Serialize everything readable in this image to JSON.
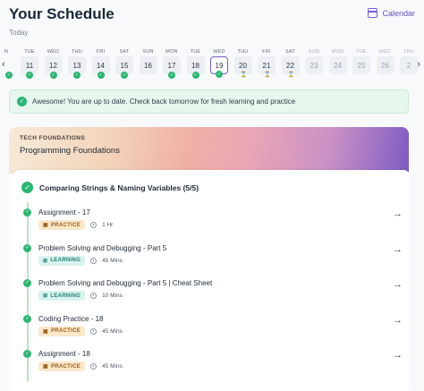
{
  "header": {
    "title": "Your Schedule",
    "calendar_label": "Calendar",
    "subtitle": "Today"
  },
  "week": {
    "days": [
      {
        "label": "N",
        "num": "",
        "state": "done"
      },
      {
        "label": "TUE",
        "num": "11",
        "state": "done"
      },
      {
        "label": "WED",
        "num": "12",
        "state": "done"
      },
      {
        "label": "THU",
        "num": "13",
        "state": "done"
      },
      {
        "label": "FRI",
        "num": "14",
        "state": "done"
      },
      {
        "label": "SAT",
        "num": "15",
        "state": "done"
      },
      {
        "label": "SUN",
        "num": "16",
        "state": "none"
      },
      {
        "label": "MON",
        "num": "17",
        "state": "done"
      },
      {
        "label": "TUE",
        "num": "18",
        "state": "done"
      },
      {
        "label": "WED",
        "num": "19",
        "state": "today"
      },
      {
        "label": "THU",
        "num": "20",
        "state": "pending"
      },
      {
        "label": "FRI",
        "num": "21",
        "state": "pending"
      },
      {
        "label": "SAT",
        "num": "22",
        "state": "pending"
      },
      {
        "label": "SUN",
        "num": "23",
        "state": "future"
      },
      {
        "label": "MON",
        "num": "24",
        "state": "future"
      },
      {
        "label": "TUE",
        "num": "25",
        "state": "future"
      },
      {
        "label": "WED",
        "num": "26",
        "state": "future"
      },
      {
        "label": "THU",
        "num": "2",
        "state": "future"
      }
    ],
    "prev_icon": "chevron-left-icon",
    "next_icon": "chevron-right-icon"
  },
  "alert": {
    "text": "Awesome! You are up to date. Check back tomorrow for fresh learning and practice"
  },
  "course": {
    "track": "TECH FOUNDATIONS",
    "title": "Programming Foundations"
  },
  "module": {
    "title": "Comparing Strings & Naming Variables (5/5)"
  },
  "tasks": [
    {
      "title": "Assignment - 17",
      "type": "PRACTICE",
      "kind": "practice",
      "duration": "1 Hr"
    },
    {
      "title": "Problem Solving and Debugging - Part 5",
      "type": "LEARNING",
      "kind": "learning",
      "duration": "45 Mins"
    },
    {
      "title": "Problem Solving and Debugging - Part 5 | Cheat Sheet",
      "type": "LEARNING",
      "kind": "learning",
      "duration": "10 Mins"
    },
    {
      "title": "Coding Practice - 18",
      "type": "PRACTICE",
      "kind": "practice",
      "duration": "45 Mins"
    },
    {
      "title": "Assignment - 18",
      "type": "PRACTICE",
      "kind": "practice",
      "duration": "45 Mins"
    }
  ],
  "colors": {
    "accent": "#7c5cd6",
    "success": "#2bb673",
    "practice_bg": "#fbe7c9",
    "learning_bg": "#d8f3ef"
  }
}
